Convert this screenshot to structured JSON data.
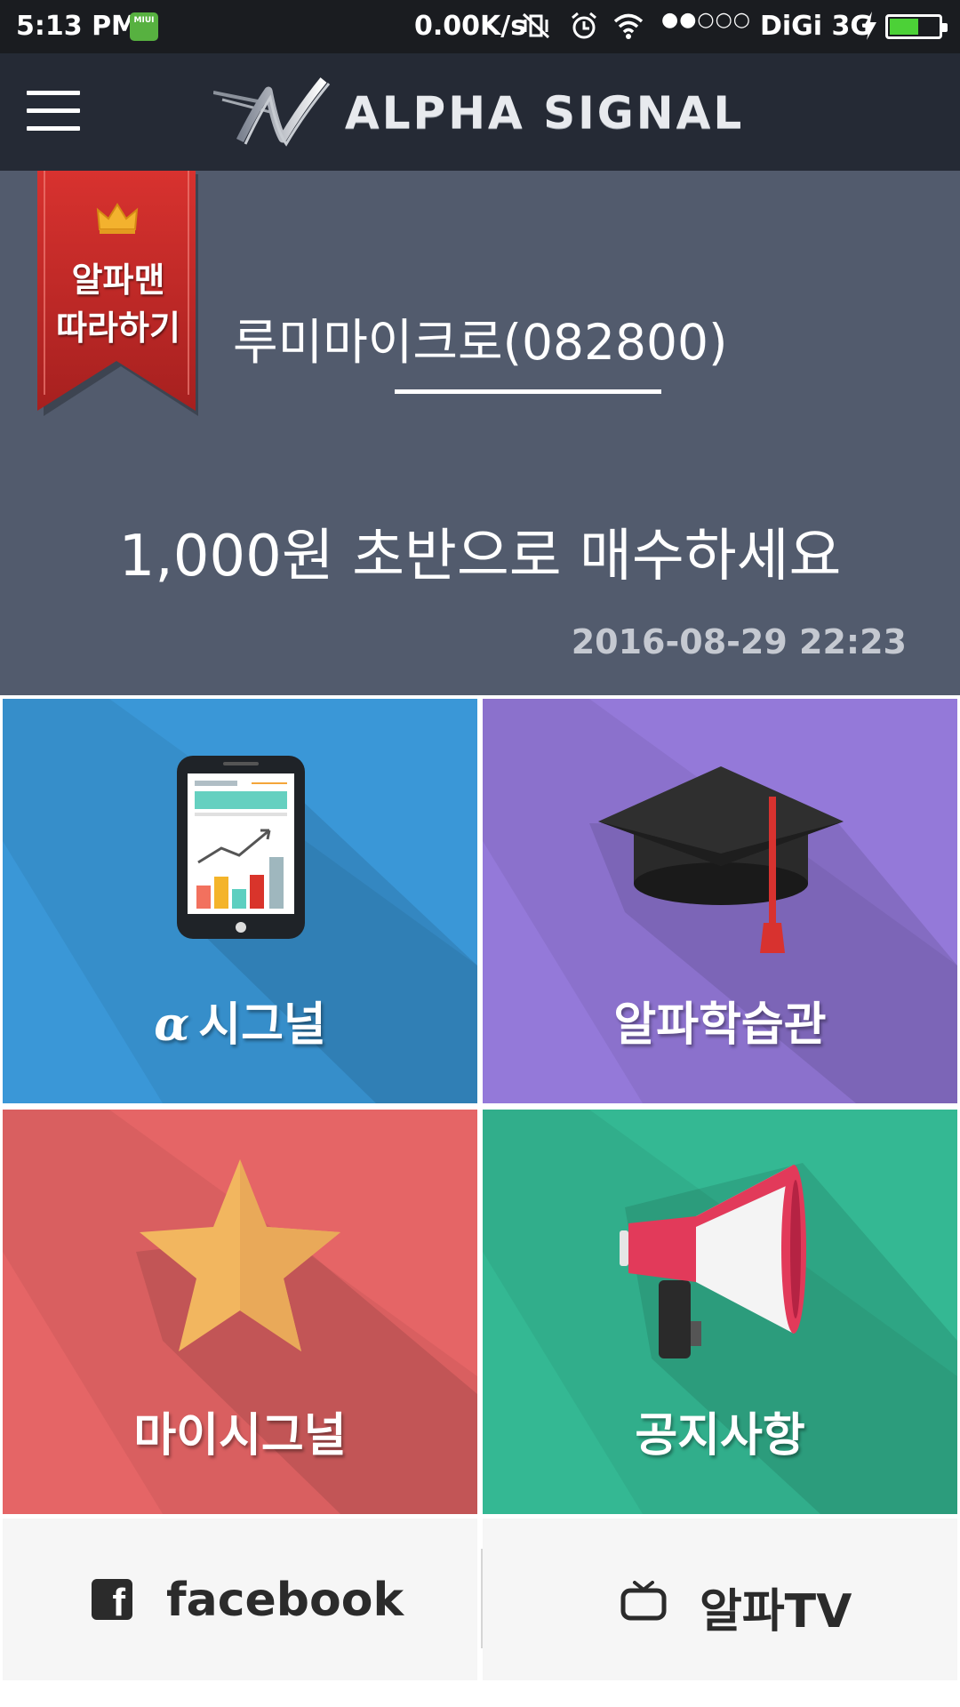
{
  "status_bar": {
    "time": "5:13 PM",
    "miui_badge": "MIUI",
    "net_speed": "0.00K/s",
    "signal_dots": "●●○○○",
    "carrier": "DiGi 3G",
    "battery_level": 0.55,
    "icons": [
      "vibrate-off-icon",
      "alarm-icon",
      "wifi-icon",
      "charging-icon",
      "battery-icon"
    ]
  },
  "app_bar": {
    "menu_icon": "hamburger-menu-icon",
    "logo_text": "ALPHA SIGNAL"
  },
  "banner": {
    "ribbon_line1": "알파맨",
    "ribbon_line2": "따라하기",
    "ribbon_icon": "crown-icon",
    "stock_name": "루미마이크로(082800)",
    "message": "1,000원 초반으로 매수하세요",
    "datetime": "2016-08-29 22:23"
  },
  "tiles": {
    "signal": {
      "alpha_symbol": "α",
      "label": "시그널",
      "icon": "tablet-chart-icon",
      "color": "#3a97d7"
    },
    "study": {
      "label": "알파학습관",
      "icon": "graduation-cap-icon",
      "color": "#9479d9"
    },
    "my_signal": {
      "label": "마이시그널",
      "icon": "star-icon",
      "color": "#e56566"
    },
    "notice": {
      "label": "공지사항",
      "icon": "megaphone-icon",
      "color": "#34b893"
    }
  },
  "bottom": {
    "facebook_label": "facebook",
    "facebook_icon": "facebook-icon",
    "tv_label": "알파TV",
    "tv_icon": "tv-icon"
  }
}
